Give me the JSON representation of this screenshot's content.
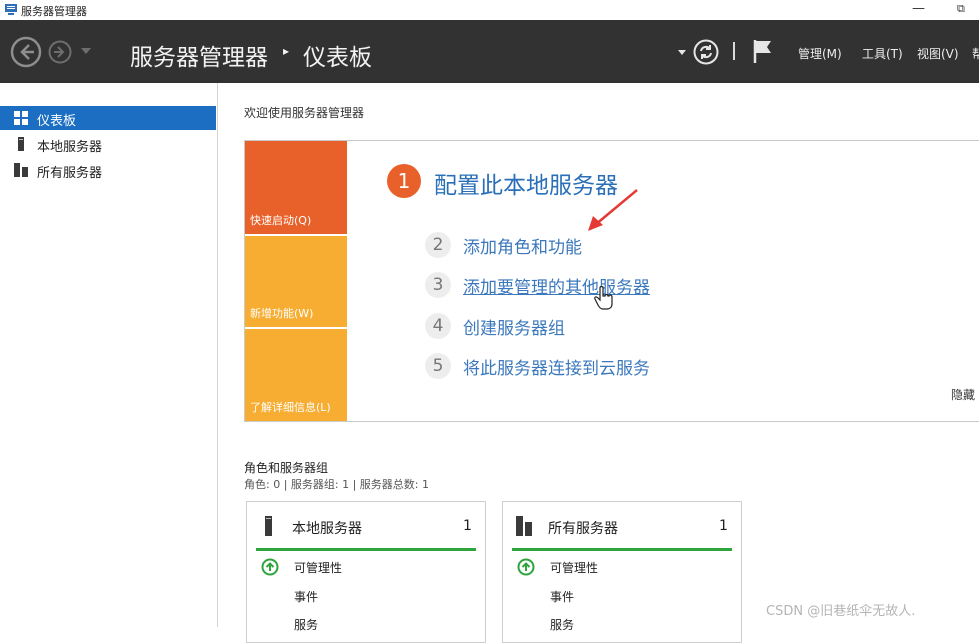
{
  "window": {
    "title": "服务器管理器",
    "min_glyph": "—",
    "max_glyph": "⧉"
  },
  "header": {
    "breadcrumb_root": "服务器管理器",
    "breadcrumb_sep": "▸",
    "breadcrumb_page": "仪表板",
    "menus": [
      "管理(M)",
      "工具(T)",
      "视图(V)",
      "帮"
    ]
  },
  "sidebar": {
    "items": [
      {
        "label": "仪表板",
        "icon": "dashboard-icon",
        "active": true
      },
      {
        "label": "本地服务器",
        "icon": "server-icon",
        "active": false
      },
      {
        "label": "所有服务器",
        "icon": "servers-icon",
        "active": false
      }
    ]
  },
  "main": {
    "welcome": "欢迎使用服务器管理器",
    "tiles": {
      "quick": "快速启动(Q)",
      "new": "新增功能(W)",
      "learn": "了解详细信息(L)"
    },
    "step1": {
      "num": "1",
      "label": "配置此本地服务器"
    },
    "steps": [
      {
        "num": "2",
        "label": "添加角色和功能"
      },
      {
        "num": "3",
        "label": "添加要管理的其他服务器"
      },
      {
        "num": "4",
        "label": "创建服务器组"
      },
      {
        "num": "5",
        "label": "将此服务器连接到云服务"
      }
    ],
    "hide": "隐藏"
  },
  "roles": {
    "title": "角色和服务器组",
    "summary": "角色: 0 | 服务器组: 1 | 服务器总数: 1",
    "cards": [
      {
        "title": "本地服务器",
        "count": "1",
        "rows": [
          "可管理性",
          "事件",
          "服务"
        ]
      },
      {
        "title": "所有服务器",
        "count": "1",
        "rows": [
          "可管理性",
          "事件",
          "服务"
        ]
      }
    ]
  },
  "watermark": "CSDN @旧巷纸伞无故人.",
  "colors": {
    "header_bg": "#323232",
    "accent_blue": "#1b6ec2",
    "tile_orange": "#e8612a",
    "tile_yellow": "#f6ad31",
    "link_blue": "#3b78bd",
    "status_green": "#2ea43f"
  }
}
